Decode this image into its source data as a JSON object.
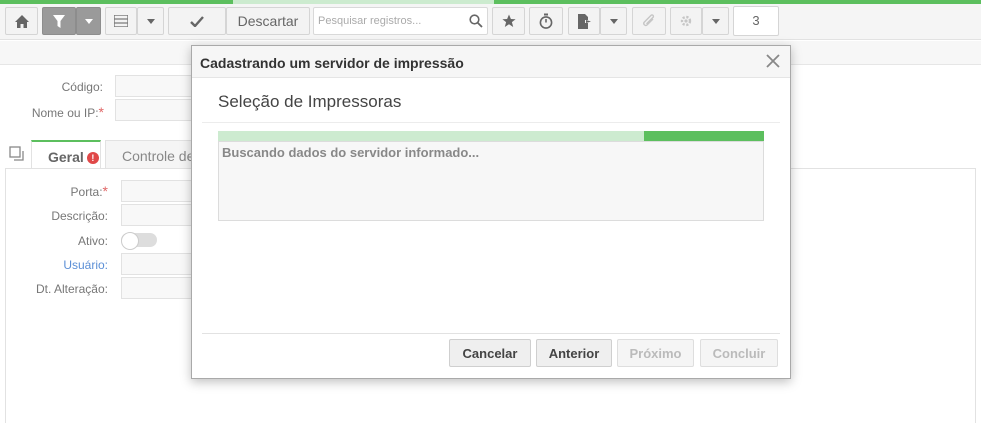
{
  "toolbar": {
    "descartar_label": "Descartar",
    "search_placeholder": "Pesquisar registros...",
    "page_number": "3"
  },
  "form": {
    "codigo_label": "Código:",
    "nome_label": "Nome ou IP:",
    "required_mark": "*",
    "porta_label": "Porta:",
    "descricao_label": "Descrição:",
    "ativo_label": "Ativo:",
    "usuario_label": "Usuário:",
    "dt_alteracao_label": "Dt. Alteração:"
  },
  "tabs": [
    {
      "label": "Geral",
      "has_error": true
    },
    {
      "label": "Controle de"
    }
  ],
  "modal": {
    "title": "Cadastrando um servidor de impressão",
    "step_title": "Seleção de Impressoras",
    "progress_percent": 22,
    "status_text": "Buscando dados do servidor informado...",
    "buttons": {
      "cancel": "Cancelar",
      "previous": "Anterior",
      "next": "Próximo",
      "finish": "Concluir"
    }
  },
  "colors": {
    "accent_green": "#5cbf5e",
    "light_green": "#cdebd0",
    "required_red": "#e06666",
    "link_blue": "#5b8fd6"
  },
  "icons": [
    "home-icon",
    "filter-icon",
    "chevron-down-icon",
    "list-icon",
    "check-icon",
    "search-icon",
    "star-icon",
    "stopwatch-icon",
    "export-icon",
    "paperclip-icon",
    "gear-icon",
    "close-icon",
    "copy-icon",
    "error-icon"
  ]
}
